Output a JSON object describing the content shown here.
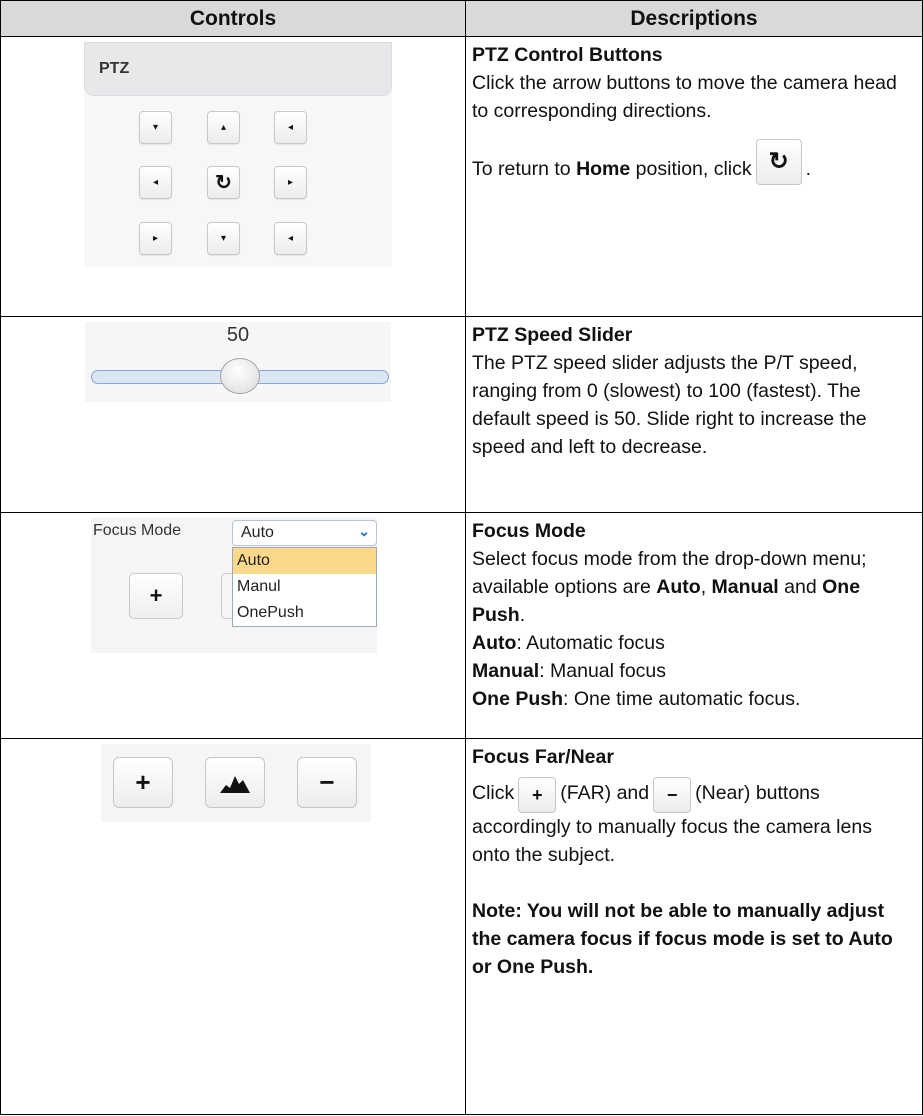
{
  "table": {
    "headers": {
      "controls": "Controls",
      "descriptions": "Descriptions"
    }
  },
  "ptz": {
    "panel_title": "PTZ",
    "buttons": [
      "▾",
      "▴",
      "◂",
      "◂",
      "↻",
      "▸",
      "▸",
      "▾",
      "◂"
    ],
    "desc": {
      "title": "PTZ Control Buttons",
      "text": "Click the arrow buttons to move the camera head to corresponding directions.",
      "home_prefix": "To return to ",
      "home_bold": "Home",
      "home_suffix": " position, click",
      "home_end": ".",
      "home_icon": "↻"
    }
  },
  "speed": {
    "value": "50",
    "level_percent": 50,
    "desc": {
      "title": "PTZ Speed Slider",
      "text": "The PTZ speed slider adjusts the P/T speed, ranging from 0 (slowest) to 100 (fastest). The default speed is 50. Slide right to increase the speed and left to decrease."
    }
  },
  "focus_mode": {
    "label": "Focus Mode",
    "selected": "Auto",
    "options": [
      "Auto",
      "Manul",
      "OnePush"
    ],
    "plus": "+",
    "desc": {
      "title": "Focus Mode",
      "line1_prefix": "Select focus mode from the drop-down menu; available options are ",
      "opt_auto": "Auto",
      "comma": ",",
      "opt_manual": "Manual",
      "and": " and ",
      "opt_onepush": "One Push",
      "period": ".",
      "auto_term": "Auto",
      "auto_def": ": Automatic focus",
      "manual_term": "Manual",
      "manual_def": ": Manual focus",
      "onepush_term": "One Push",
      "onepush_def": ": One time automatic focus."
    }
  },
  "focus_far_near": {
    "buttons": {
      "far": "+",
      "auto": "auto-focus-icon",
      "near": "−"
    },
    "desc": {
      "title": "Focus Far/Near",
      "click": "Click",
      "far_label": "(FAR) and",
      "near_label": "(Near)",
      "text": "buttons accordingly to manually focus the camera lens onto the subject.",
      "note": "Note: You will not be able to manually adjust the camera focus if focus mode is set to Auto or One Push."
    }
  }
}
